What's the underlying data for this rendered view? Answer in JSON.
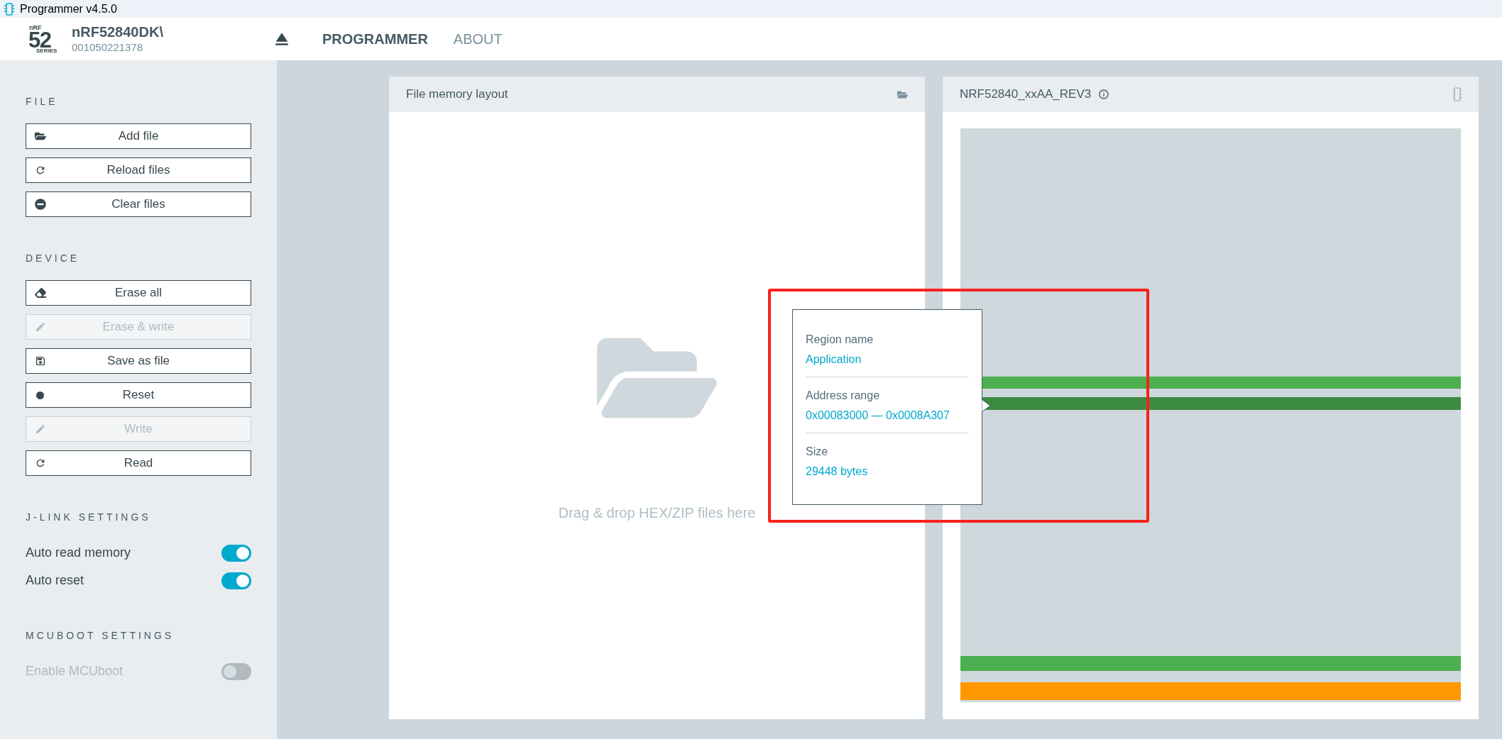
{
  "window": {
    "title": "Programmer v4.5.0"
  },
  "header": {
    "logo": {
      "top": "nRF",
      "number": "52",
      "bottom": "SERIES"
    },
    "device_name": "nRF52840DK\\",
    "serial": "001050221378",
    "nav": [
      {
        "label": "PROGRAMMER",
        "selected": true
      },
      {
        "label": "ABOUT",
        "selected": false
      }
    ]
  },
  "sidebar": {
    "sections": [
      {
        "title": "FILE",
        "items": [
          {
            "kind": "button",
            "label": "Add file",
            "disabled": false
          },
          {
            "kind": "button",
            "label": "Reload files",
            "disabled": false
          },
          {
            "kind": "button",
            "label": "Clear files",
            "disabled": false
          }
        ]
      },
      {
        "title": "DEVICE",
        "items": [
          {
            "kind": "button",
            "label": "Erase all",
            "disabled": false
          },
          {
            "kind": "button",
            "label": "Erase & write",
            "disabled": true
          },
          {
            "kind": "button",
            "label": "Save as file",
            "disabled": false
          },
          {
            "kind": "button",
            "label": "Reset",
            "disabled": false
          },
          {
            "kind": "button",
            "label": "Write",
            "disabled": true
          },
          {
            "kind": "button",
            "label": "Read",
            "disabled": false
          }
        ]
      },
      {
        "title": "J-LINK SETTINGS",
        "items": [
          {
            "kind": "toggle",
            "label": "Auto read memory",
            "on": true,
            "disabled": false
          },
          {
            "kind": "toggle",
            "label": "Auto reset",
            "on": true,
            "disabled": false
          }
        ]
      },
      {
        "title": "MCUBOOT SETTINGS",
        "items": [
          {
            "kind": "toggle",
            "label": "Enable MCUboot",
            "on": false,
            "disabled": true
          }
        ]
      }
    ]
  },
  "file_panel": {
    "title": "File memory layout",
    "drop_hint": "Drag & drop HEX/ZIP files here"
  },
  "device_panel": {
    "title": "NRF52840_xxAA_REV3",
    "regions": [
      {
        "color": "#4caf50"
      },
      {
        "color": "#3d8b40"
      },
      {
        "color": "#4caf50"
      },
      {
        "color": "#ff9800"
      }
    ],
    "tooltip": {
      "fields": [
        {
          "label": "Region name",
          "value": "Application"
        },
        {
          "label": "Address range",
          "value": "0x00083000 — 0x0008A307"
        },
        {
          "label": "Size",
          "value": "29448 bytes"
        }
      ]
    }
  }
}
